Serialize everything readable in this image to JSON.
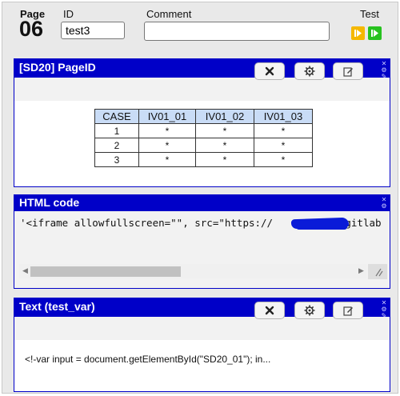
{
  "header": {
    "page_label": "Page",
    "page_number": "06",
    "id_label": "ID",
    "id_value": "test3",
    "comment_label": "Comment",
    "comment_value": "",
    "test_label": "Test"
  },
  "panels": [
    {
      "title": "[SD20] PageID",
      "table": {
        "headers": [
          "CASE",
          "IV01_01",
          "IV01_02",
          "IV01_03"
        ],
        "rows": [
          [
            "1",
            "*",
            "*",
            "*"
          ],
          [
            "2",
            "*",
            "*",
            "*"
          ],
          [
            "3",
            "*",
            "*",
            "*"
          ]
        ]
      }
    },
    {
      "title": "HTML code",
      "code_text": "'<iframe allowfullscreen=\"\", src=\"https://            gitlab"
    },
    {
      "title": "Text (test_var)",
      "text": "<!-var input = document.getElementById(\"SD20_01\"); in..."
    }
  ],
  "colors": {
    "panel_blue": "#0000c8",
    "table_header": "#c9dcf6",
    "test_orange": "#f5b800",
    "test_green": "#27c21f"
  },
  "icons": [
    "close-icon",
    "gear-icon",
    "edit-icon",
    "play-step-icon",
    "play-icon",
    "scroll-left-icon",
    "scroll-right-icon",
    "resize-grip-icon"
  ]
}
